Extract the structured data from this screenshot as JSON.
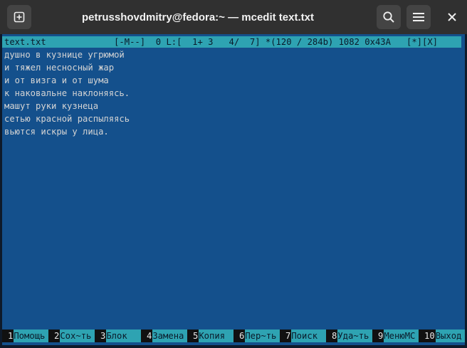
{
  "window": {
    "title": "petrusshovdmitry@fedora:~ — mcedit text.txt"
  },
  "toolbar": {
    "icons": [
      "new-tab-icon",
      "search-icon",
      "hamburger-menu-icon",
      "close-icon"
    ]
  },
  "statusbar": {
    "text": "text.txt             [-M--]  0 L:[  1+ 3   4/  7] *(120 / 284b) 1082 0x43A   [*][X]"
  },
  "editor": {
    "lines": [
      "душно в кузнице угрюмой",
      "и тяжел несносный жар",
      "и от визга и от шума",
      "к наковальне наклоняясь.",
      "машут руки кузнеца",
      "сетью красной распыляясь",
      "вьются искры у лица."
    ]
  },
  "fkeys": [
    {
      "num": "1",
      "label": "Помощь"
    },
    {
      "num": "2",
      "label": "Сох~ть"
    },
    {
      "num": "3",
      "label": "Блок"
    },
    {
      "num": "4",
      "label": "Замена"
    },
    {
      "num": "5",
      "label": "Копия"
    },
    {
      "num": "6",
      "label": "Пер~ть"
    },
    {
      "num": "7",
      "label": "Поиск"
    },
    {
      "num": "8",
      "label": "Уда~ть"
    },
    {
      "num": "9",
      "label": "МенюМС"
    },
    {
      "num": "10",
      "label": "Выход"
    }
  ],
  "colors": {
    "editor_bg": "#14508c",
    "bar_accent": "#2ea3b2",
    "titlebar_bg": "#303030"
  }
}
